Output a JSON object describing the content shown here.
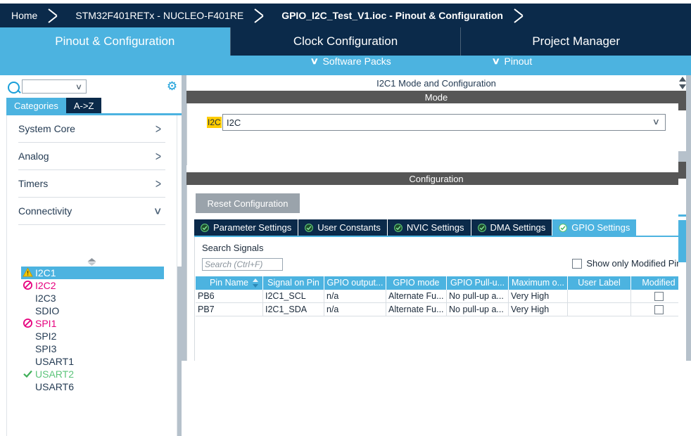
{
  "toolbar": {
    "cut_off_label": ""
  },
  "breadcrumb": {
    "items": [
      {
        "label": "Home",
        "active": false
      },
      {
        "label": "STM32F401RETx  -  NUCLEO-F401RE",
        "active": false
      },
      {
        "label": "GPIO_I2C_Test_V1.ioc - Pinout & Configuration",
        "active": true
      }
    ]
  },
  "nav": {
    "tabs": [
      {
        "label": "Pinout & Configuration",
        "active": true
      },
      {
        "label": "Clock Configuration",
        "active": false
      },
      {
        "label": "Project Manager",
        "active": false
      }
    ]
  },
  "subnav": {
    "chevron": "∨",
    "items": [
      {
        "label": "Software Packs"
      },
      {
        "label": "Pinout"
      }
    ]
  },
  "sidebar": {
    "search": {
      "placeholder": "",
      "value": ""
    },
    "gear_icon": "gear-icon",
    "tabs": [
      {
        "label": "Categories",
        "selected": true
      },
      {
        "label": "A->Z",
        "selected": false
      }
    ],
    "categories": [
      {
        "label": "System Core",
        "expanded": false
      },
      {
        "label": "Analog",
        "expanded": false
      },
      {
        "label": "Timers",
        "expanded": false
      },
      {
        "label": "Connectivity",
        "expanded": true
      }
    ],
    "peripherals": [
      {
        "label": "I2C1",
        "status": "warning",
        "selected": true
      },
      {
        "label": "I2C2",
        "status": "denied",
        "selected": false
      },
      {
        "label": "I2C3",
        "status": "none",
        "selected": false
      },
      {
        "label": "SDIO",
        "status": "none",
        "selected": false
      },
      {
        "label": "SPI1",
        "status": "denied",
        "selected": false
      },
      {
        "label": "SPI2",
        "status": "none",
        "selected": false
      },
      {
        "label": "SPI3",
        "status": "none",
        "selected": false
      },
      {
        "label": "USART1",
        "status": "none",
        "selected": false
      },
      {
        "label": "USART2",
        "status": "ok",
        "selected": false
      },
      {
        "label": "USART6",
        "status": "none",
        "selected": false
      }
    ]
  },
  "right_panel": {
    "title": "I2C1 Mode and Configuration",
    "mode": {
      "band_label": "Mode",
      "chip_label": "I2C",
      "select_value": "I2C",
      "select_arrow": "∨"
    },
    "configuration": {
      "band_label": "Configuration",
      "reset_button": "Reset Configuration",
      "tabs": [
        {
          "label": "Parameter Settings",
          "active": false
        },
        {
          "label": "User Constants",
          "active": false
        },
        {
          "label": "NVIC Settings",
          "active": false
        },
        {
          "label": "DMA Settings",
          "active": false
        },
        {
          "label": "GPIO Settings",
          "active": true
        }
      ],
      "gpio": {
        "search_label": "Search Signals",
        "search_placeholder": "Search (Ctrl+F)",
        "search_value": "",
        "show_modified_label": "Show only Modified Pins",
        "show_modified_checked": false,
        "table": {
          "columns": [
            "Pin Name",
            "Signal on Pin",
            "GPIO output...",
            "GPIO mode",
            "GPIO Pull-u...",
            "Maximum o...",
            "User Label",
            "Modified"
          ],
          "sorted_column": "Pin Name",
          "rows": [
            {
              "pin_name": "PB6",
              "signal_on_pin": "I2C1_SCL",
              "gpio_output": "n/a",
              "gpio_mode": "Alternate Fu...",
              "gpio_pull": "No pull-up a...",
              "maximum_output": "Very High",
              "user_label": "",
              "modified": false
            },
            {
              "pin_name": "PB7",
              "signal_on_pin": "I2C1_SDA",
              "gpio_output": "n/a",
              "gpio_mode": "Alternate Fu...",
              "gpio_pull": "No pull-up a...",
              "maximum_output": "Very High",
              "user_label": "",
              "modified": false
            }
          ]
        }
      }
    }
  },
  "colors": {
    "dark_navy": "#0b2a4a",
    "accent_blue": "#4cb3e0",
    "band_gray": "#565656",
    "warning_yellow": "#f2c200",
    "denied_pink": "#e6007e",
    "ok_green": "#41b05a",
    "highlight_yellow": "#ffcc00"
  }
}
